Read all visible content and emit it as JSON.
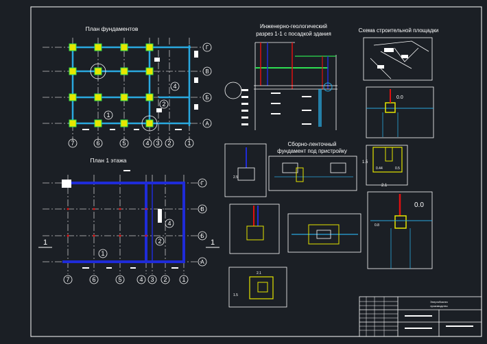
{
  "drawing": {
    "colors": {
      "background": "#1b1f25",
      "frame": "#ffffff",
      "axis": "#c8c8c8",
      "wall_blue": "#1f2bd8",
      "foundation_cyan": "#2aa9e0",
      "column_yellow": "#e6e600",
      "column_green": "#2ee052",
      "red": "#e01010",
      "text": "#ffffff"
    },
    "titles": {
      "foundation_plan": "План фундаментов",
      "first_floor_plan": "План 1 этажа",
      "geo_section_line1": "Инженерно-геологический",
      "geo_section_line2": "разрез 1-1 с посадкой здания",
      "site_plan": "Схема строительной площадки",
      "precast_line1": "Сборно-ленточный",
      "precast_line2": "фундамент под пристройку"
    },
    "axes": {
      "numeric": [
        "7",
        "6",
        "5",
        "4",
        "3",
        "2",
        "1"
      ],
      "letter": [
        "Г",
        "В",
        "Б",
        "А"
      ]
    },
    "markers": {
      "area_1": "1",
      "area_2": "2",
      "area_4": "4",
      "section": "1"
    },
    "dimensions": {
      "level_a": "0.0",
      "level_b": "0.0",
      "width_a": "1.5",
      "width_b": "2.1",
      "w_044": "0.44",
      "w_05": "0.5",
      "d_25": "2.5",
      "d_08": "0.8",
      "d_15": "1.5",
      "d_21": "2.1"
    },
    "title_block": {
      "line1": "Энергобизнес",
      "line2": "производство"
    }
  }
}
